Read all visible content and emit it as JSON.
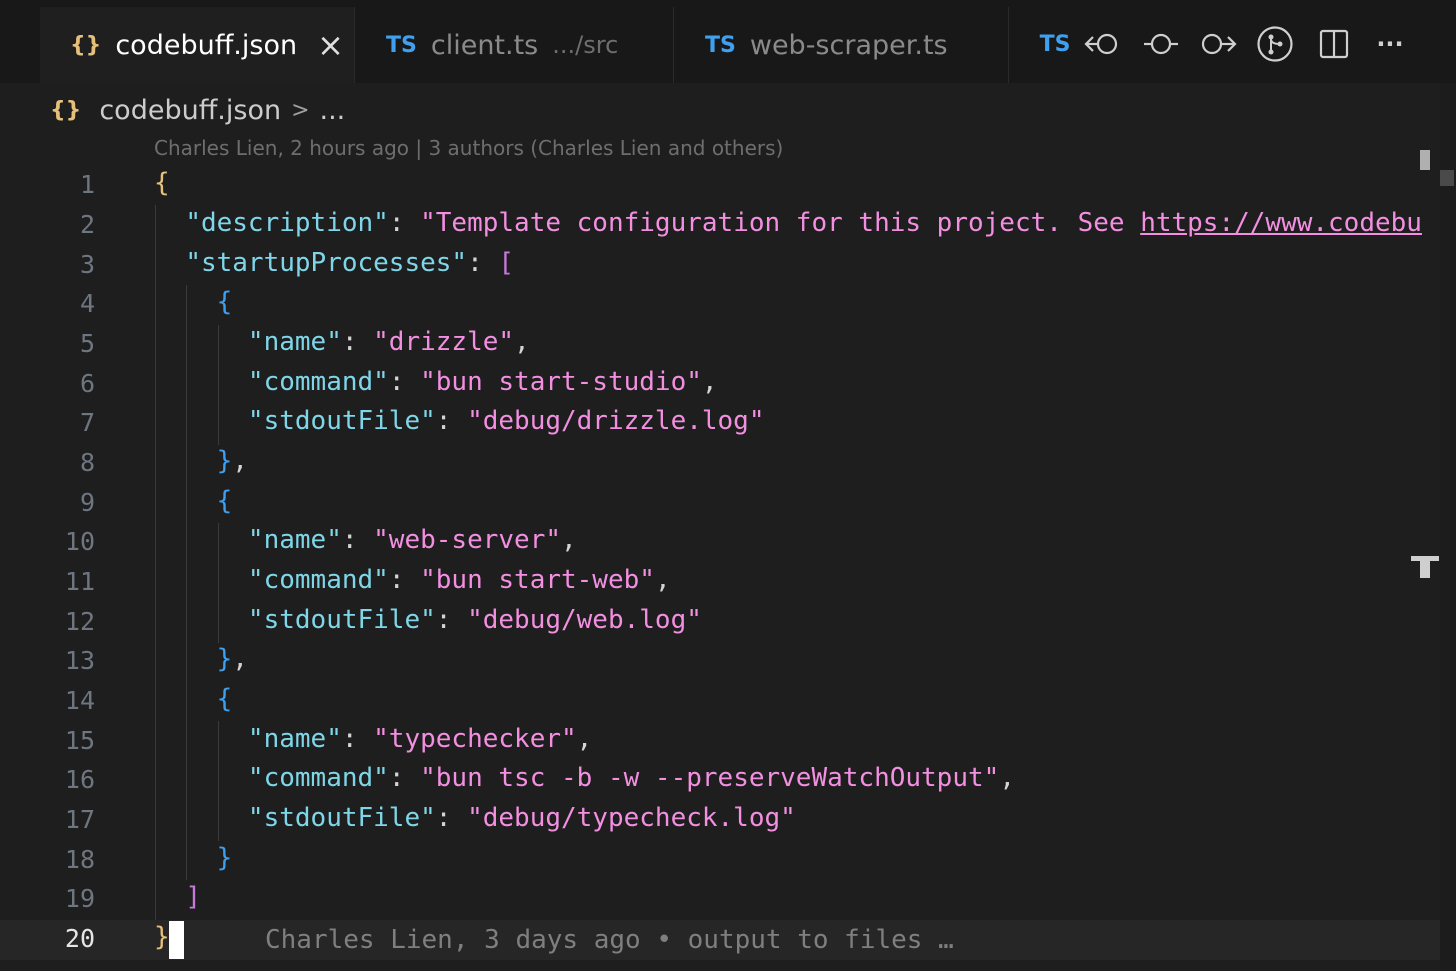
{
  "tabs": [
    {
      "icon": "{}",
      "label": "codebuff.json",
      "desc": "",
      "close": "×",
      "active": true
    },
    {
      "icon": "TS",
      "label": "client.ts",
      "desc": ".../src",
      "close": "",
      "active": false
    },
    {
      "icon": "TS",
      "label": "web-scraper.ts",
      "desc": "",
      "close": "",
      "active": false
    }
  ],
  "toolbar": {
    "ts_label": "TS",
    "more": "···"
  },
  "breadcrumb": {
    "icon": "{}",
    "file": "codebuff.json",
    "sep": ">",
    "more": "..."
  },
  "blame_header": "Charles Lien, 2 hours ago | 3 authors (Charles Lien and others)",
  "inline_blame": "Charles Lien, 3 days ago • output to files …",
  "line_numbers": [
    "1",
    "2",
    "3",
    "4",
    "5",
    "6",
    "7",
    "8",
    "9",
    "10",
    "11",
    "12",
    "13",
    "14",
    "15",
    "16",
    "17",
    "18",
    "19",
    "20"
  ],
  "code": {
    "l1_brace": "{",
    "l2_key": "\"description\"",
    "l2_val": "\"Template configuration for this project. See ",
    "l2_url": "https://www.codebu",
    "l3_key": "\"startupProcesses\"",
    "l3_open": "[",
    "l4": "{",
    "l5_key": "\"name\"",
    "l5_val": "\"drizzle\"",
    "l6_key": "\"command\"",
    "l6_val": "\"bun start-studio\"",
    "l7_key": "\"stdoutFile\"",
    "l7_val": "\"debug/drizzle.log\"",
    "l8": "}",
    "l9": "{",
    "l10_key": "\"name\"",
    "l10_val": "\"web-server\"",
    "l11_key": "\"command\"",
    "l11_val": "\"bun start-web\"",
    "l12_key": "\"stdoutFile\"",
    "l12_val": "\"debug/web.log\"",
    "l13": "}",
    "l14": "{",
    "l15_key": "\"name\"",
    "l15_val": "\"typechecker\"",
    "l16_key": "\"command\"",
    "l16_val": "\"bun tsc -b -w --preserveWatchOutput\"",
    "l17_key": "\"stdoutFile\"",
    "l17_val": "\"debug/typecheck.log\"",
    "l18": "}",
    "l19": "]",
    "l20": "}"
  },
  "colors": {
    "bg": "#1e1e1e",
    "key": "#7ed6e8",
    "string": "#f28fe0",
    "ts": "#3fa0f0",
    "json_icon": "#e5c07b"
  }
}
